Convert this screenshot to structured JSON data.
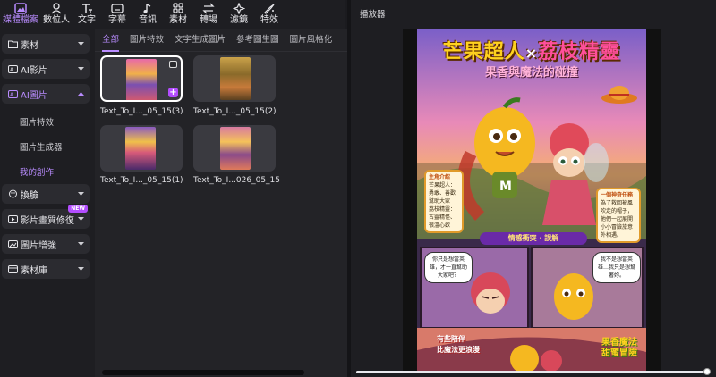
{
  "toolbar": {
    "items": [
      {
        "label": "媒體檔案",
        "icon": "media-files-icon"
      },
      {
        "label": "數位人",
        "icon": "digital-human-icon"
      },
      {
        "label": "文字",
        "icon": "text-icon"
      },
      {
        "label": "字幕",
        "icon": "subtitle-icon"
      },
      {
        "label": "音訊",
        "icon": "audio-icon"
      },
      {
        "label": "素材",
        "icon": "assets-icon"
      },
      {
        "label": "轉場",
        "icon": "transition-icon"
      },
      {
        "label": "濾鏡",
        "icon": "filter-icon"
      },
      {
        "label": "特效",
        "icon": "effects-icon"
      }
    ]
  },
  "sidebar": {
    "items": [
      {
        "label": "素材",
        "icon": "folder-icon"
      },
      {
        "label": "AI影片",
        "icon": "ai-video-icon"
      },
      {
        "label": "AI圖片",
        "icon": "ai-image-icon"
      },
      {
        "label": "換臉",
        "icon": "face-swap-icon"
      },
      {
        "label": "影片畫質修復",
        "icon": "video-repair-icon",
        "badge": "NEW"
      },
      {
        "label": "圖片增強",
        "icon": "image-enhance-icon"
      },
      {
        "label": "素材庫",
        "icon": "library-icon"
      }
    ],
    "sub_items": [
      "圖片特效",
      "圖片生成器",
      "我的創作"
    ]
  },
  "browser": {
    "tabs": [
      "全部",
      "圖片特效",
      "文字生成圖片",
      "參考圖生圖",
      "圖片風格化"
    ],
    "cards": [
      {
        "caption": "Text_To_I..._05_15(3)"
      },
      {
        "caption": "Text_To_I..._05_15(2)"
      },
      {
        "caption": "Text_To_I..._05_15(1)"
      },
      {
        "caption": "Text_To_I...026_05_15"
      }
    ]
  },
  "player": {
    "title": "播放器",
    "poster": {
      "title_left": "芒果超人",
      "title_x": "×",
      "title_right": "荔枝精靈",
      "subtitle": "果香與魔法的碰撞",
      "intro_heading": "主角介紹",
      "intro_mango": "芒果超人：勇敢、善歡幫助大家",
      "intro_lychee": "荔枝精靈：古靈精怪、很溫心歡",
      "right_box_heading": "一個神奇任務",
      "right_box_text": "為了救回被風吹走的帽子，他們一起展開小小冒險旅意外相遇。",
      "banner": "情感衝突 · 誤解",
      "bubble_left": "你只是想當英雄，才一直幫助大家吧？",
      "bubble_right": "我不是想當英雄…我只是想幫著妳。",
      "footer_line1": "有些陪伴",
      "footer_line2": "比魔法更浪漫",
      "logo_line1": "果香魔法",
      "logo_line2": "甜蜜冒險"
    }
  },
  "colors": {
    "accent": "#b98cff",
    "badge": "#b34dff",
    "background": "#1b1b1f"
  }
}
